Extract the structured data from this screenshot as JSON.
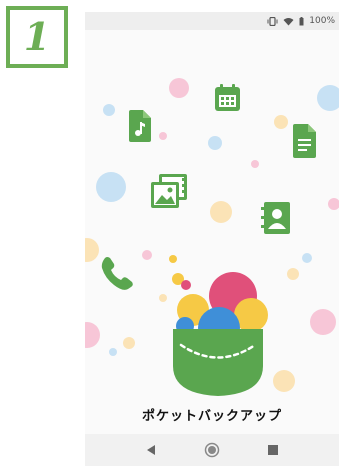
{
  "step": {
    "number": "1"
  },
  "status_bar": {
    "battery_percent": "100%",
    "icons": [
      "vibrate-icon",
      "wifi-icon",
      "battery-icon"
    ]
  },
  "app": {
    "name": "ポケットバックアップ",
    "floating_icons": [
      "calendar-icon",
      "music-file-icon",
      "document-icon",
      "photo-gallery-icon",
      "contacts-icon",
      "phone-icon"
    ]
  },
  "nav_bar": {
    "buttons": [
      "back-button",
      "home-button",
      "recents-button"
    ]
  },
  "colors": {
    "accent_green": "#6dae55",
    "icon_green": "#5aa64f",
    "pink": "#e0507a",
    "yellow": "#f6c945",
    "blue": "#3f8fd8"
  }
}
